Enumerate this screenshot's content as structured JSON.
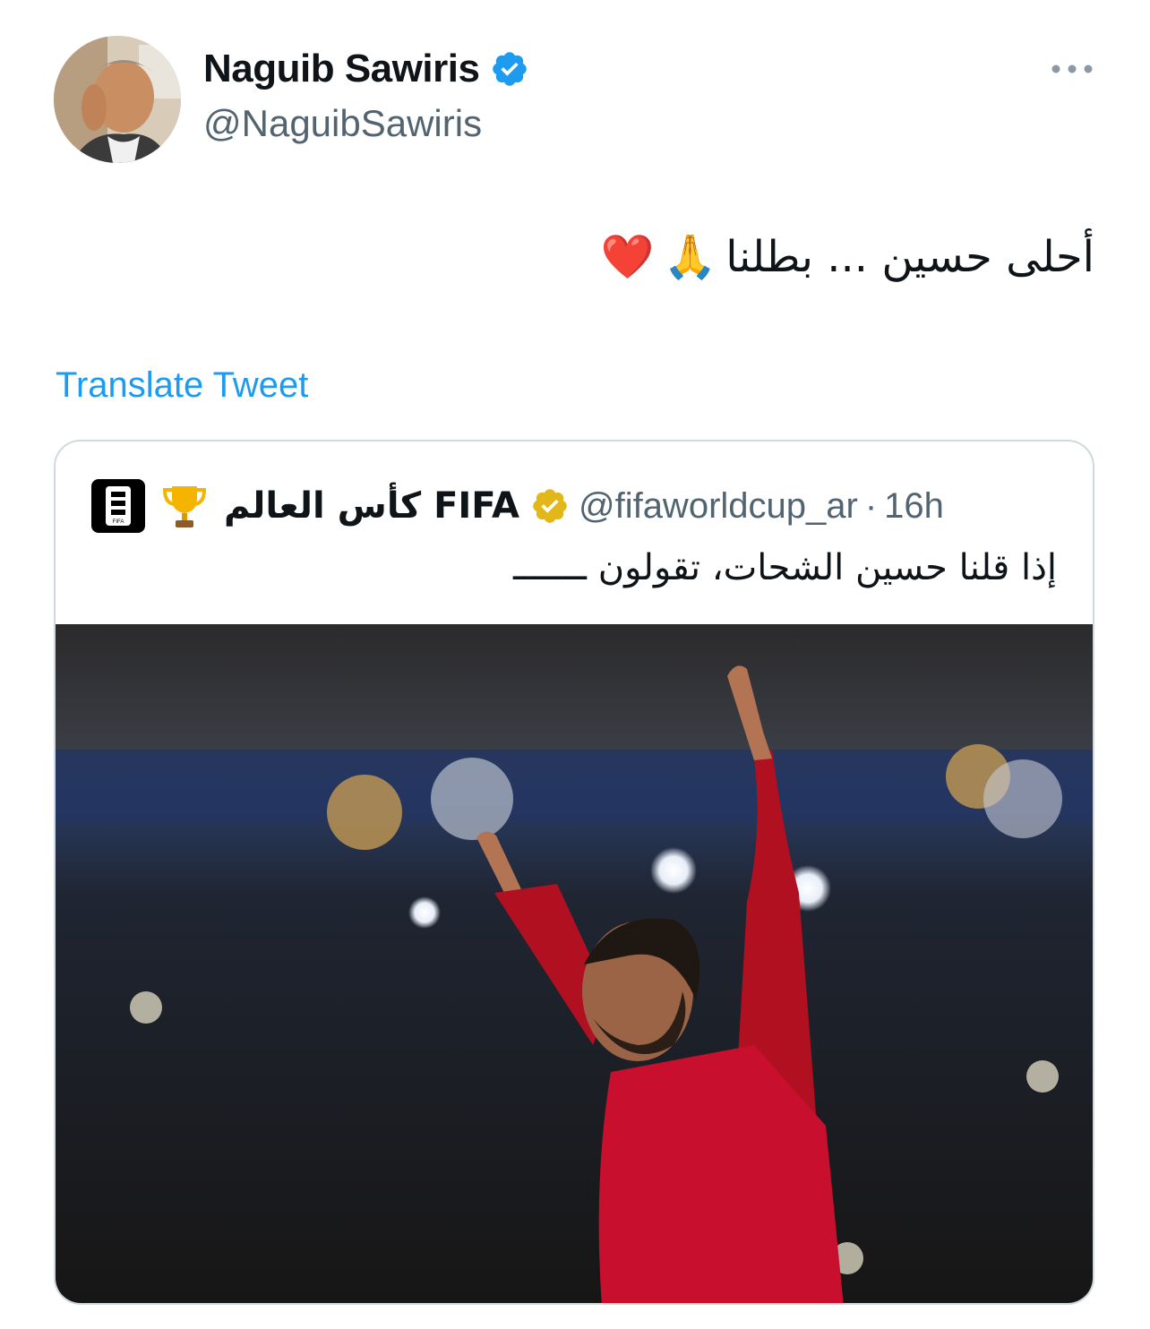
{
  "author": {
    "display_name": "Naguib Sawiris",
    "handle": "@NaguibSawiris",
    "avatar_icon": "profile-photo",
    "verified_icon": "verified-badge-icon"
  },
  "more_icon": "more-options-icon",
  "tweet": {
    "text": "أحلى حسين ... بطلنا",
    "emojis": [
      "🙏",
      "❤️"
    ]
  },
  "translate_label": "Translate Tweet",
  "quoted": {
    "name_prefix": "FIFA",
    "name_arabic": "كأس العالم",
    "handle": "@fifaworldcup_ar",
    "separator": "·",
    "time": "16h",
    "text": "إذا قلنا حسين الشحات، تقولون ـــــــ",
    "logo_text": "FIFA",
    "image": "footballer-celebrating-photo"
  },
  "colors": {
    "link": "#1d9bf0",
    "muted": "#536471",
    "border": "#cfd9de",
    "jersey_red": "#c8102e",
    "verified_blue": "#1d9bf0",
    "verified_gold": "#e2b719"
  }
}
